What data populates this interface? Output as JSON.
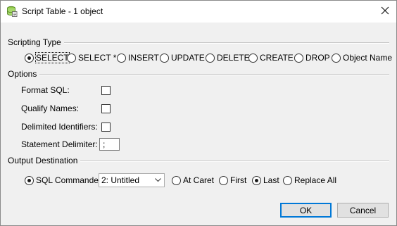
{
  "window": {
    "title": "Script Table - 1 object",
    "icon": "database-script-icon",
    "close_icon": "close-icon"
  },
  "scripting_type": {
    "label": "Scripting Type",
    "selected": "SELECT",
    "options": [
      "SELECT",
      "SELECT *",
      "INSERT",
      "UPDATE",
      "DELETE",
      "CREATE",
      "DROP",
      "Object Name"
    ]
  },
  "options": {
    "label": "Options",
    "format_sql": {
      "label": "Format SQL:",
      "checked": false
    },
    "qualify_names": {
      "label": "Qualify Names:",
      "checked": false
    },
    "delimited_identifiers": {
      "label": "Delimited Identifiers:",
      "checked": false
    },
    "statement_delimiter": {
      "label": "Statement Delimiter:",
      "value": ";"
    }
  },
  "output_destination": {
    "label": "Output Destination",
    "sql_commander": "SQL Commander",
    "commander_tab": "2: Untitled",
    "at_caret": "At Caret",
    "first": "First",
    "last": "Last",
    "replace_all": "Replace All",
    "selected": "SQL Commander",
    "position_selected": "Last"
  },
  "buttons": {
    "ok": "OK",
    "cancel": "Cancel"
  }
}
